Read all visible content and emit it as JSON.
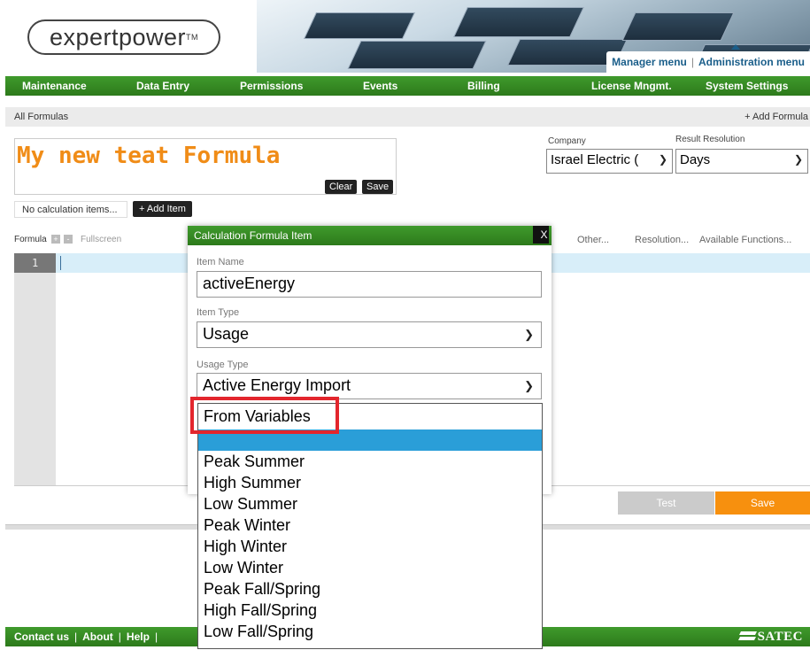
{
  "header": {
    "logo_text": "expertpower",
    "logo_tm": "TM",
    "menu_tabs": [
      "Manager menu",
      "Administration menu"
    ]
  },
  "nav": {
    "items": [
      "Maintenance",
      "Data Entry",
      "Permissions",
      "Events",
      "Billing",
      "License Mngmt.",
      "System Settings"
    ]
  },
  "breadcrumb": {
    "current": "All Formulas",
    "add_formula": "+ Add Formula"
  },
  "formula": {
    "title": "My new teat Formula",
    "clear_label": "Clear",
    "save_label": "Save",
    "company_label": "Company",
    "company_value": "Israel Electric (",
    "resolution_label": "Result Resolution",
    "resolution_value": "Days",
    "calc_items_text": "No calculation items...",
    "add_item_label": "+ Add Item"
  },
  "toolbar": {
    "formula_label": "Formula",
    "plus": "+",
    "minus": "-",
    "fullscreen": "Fullscreen",
    "other": "Other...",
    "resolution": "Resolution...",
    "available_functions": "Available Functions..."
  },
  "editor": {
    "line_number": "1"
  },
  "actions": {
    "test_label": "Test",
    "save_label": "Save"
  },
  "dialog": {
    "title": "Calculation Formula Item",
    "close_label": "X",
    "item_name_label": "Item Name",
    "item_name_value": "activeEnergy",
    "item_type_label": "Item Type",
    "item_type_value": "Usage",
    "usage_type_label": "Usage Type",
    "usage_type_value": "Active Energy Import"
  },
  "dropdown": {
    "options": [
      "From Variables",
      "",
      "Peak Summer",
      "High Summer",
      "Low Summer",
      "Peak Winter",
      "High Winter",
      "Low Winter",
      "Peak Fall/Spring",
      "High Fall/Spring",
      "Low Fall/Spring"
    ]
  },
  "footer": {
    "links": [
      "Contact us",
      "About",
      "Help"
    ],
    "brand": "SATEC"
  },
  "colors": {
    "nav_green": "#2d7a1b",
    "title_orange": "#f08c17",
    "save_orange": "#f7900e",
    "highlight_blue": "#2a9ed8",
    "callout_red": "#e3262d"
  }
}
